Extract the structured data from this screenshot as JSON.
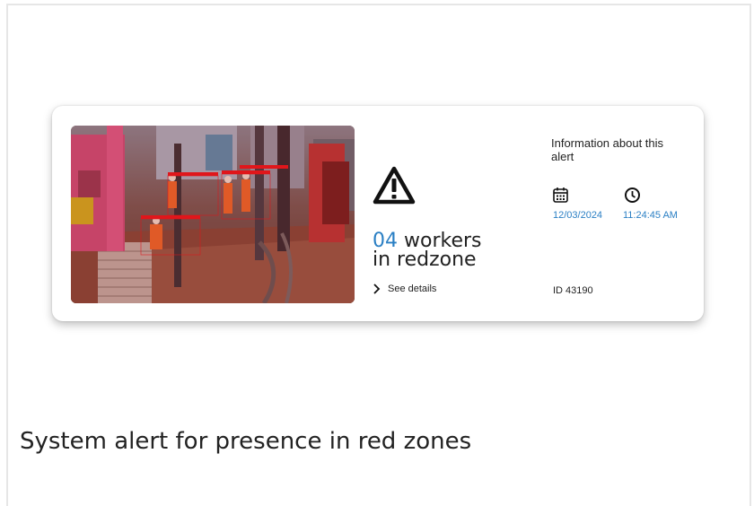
{
  "alert": {
    "count": "04",
    "count_text_line1": "workers",
    "count_text_line2": "in redzone",
    "see_details_label": "See details",
    "info_title": "Information about this alert",
    "date": "12/03/2024",
    "time": "11:24:45 AM",
    "id_label": "ID 43190",
    "icons": {
      "warning": "warning-triangle-icon",
      "calendar": "calendar-icon",
      "clock": "clock-icon",
      "chevron": "chevron-right-icon"
    }
  },
  "caption": "System alert for presence in red zones",
  "colors": {
    "accent": "#2a7fc4",
    "text": "#222222",
    "redzone": "#e0161b"
  }
}
